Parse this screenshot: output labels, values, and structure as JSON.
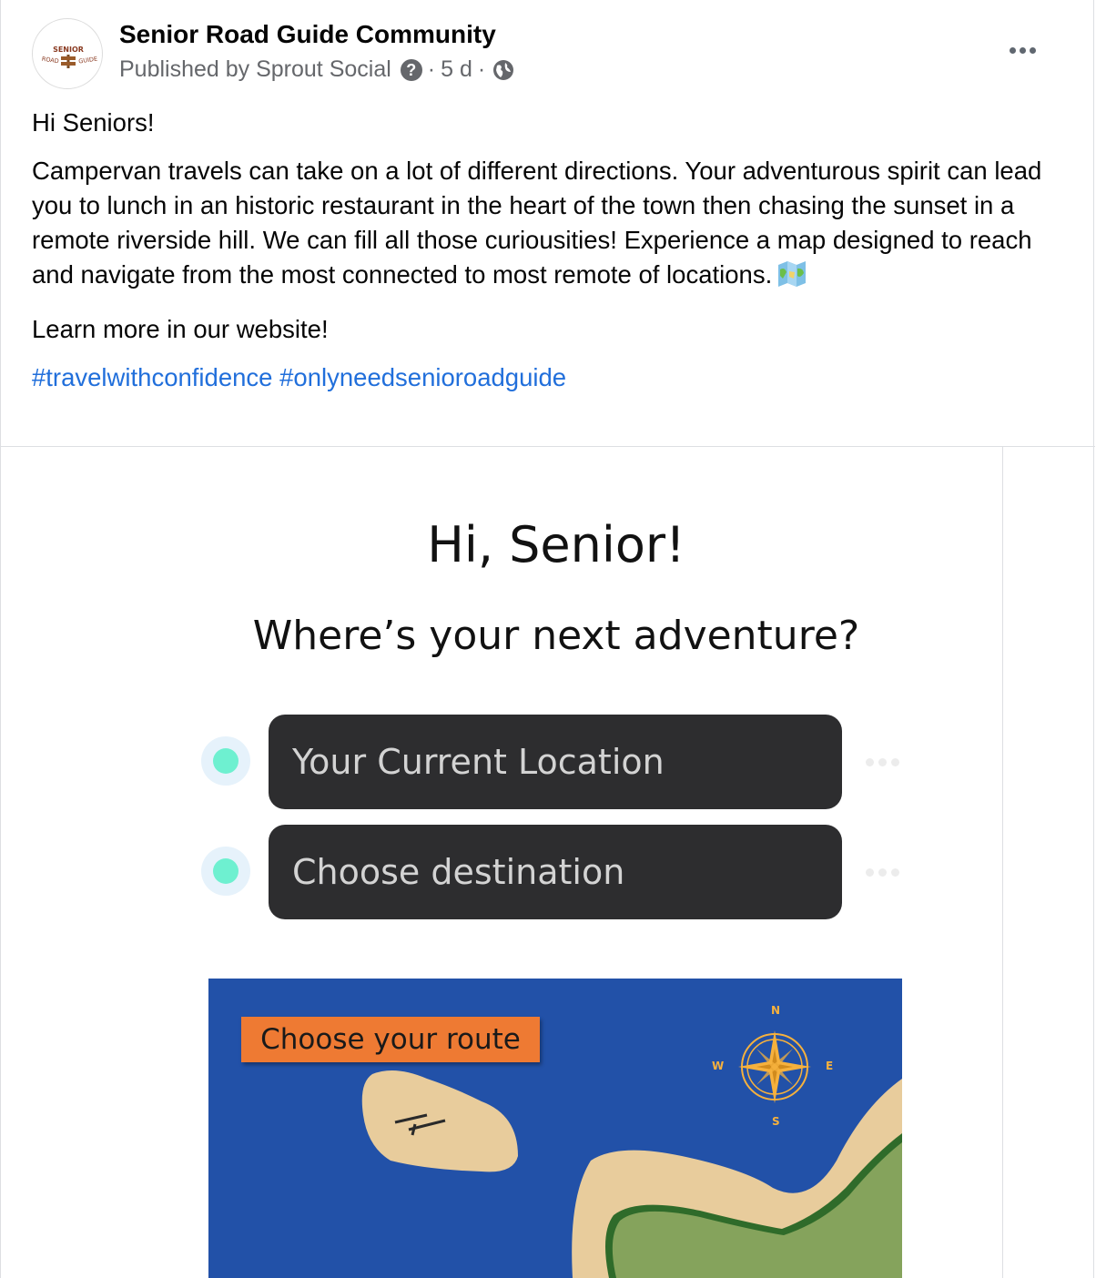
{
  "post": {
    "page_name": "Senior Road Guide Community",
    "published_by": "Published by Sprout Social",
    "help_symbol": "?",
    "separator": "·",
    "time": "5 d",
    "avatar_logo_text": "SENIOR ROAD GUIDE",
    "greeting": "Hi Seniors!",
    "paragraph": "Campervan travels can take on a lot of different directions. Your adventurous spirit can lead you to lunch in an historic restaurant in the heart of the town then chasing the sunset in a remote riverside hill. We can fill all those curiousities! Experience a map designed to reach and navigate from the most connected to most remote of locations.",
    "cta": "Learn more in our website!",
    "hashtags": [
      "#travelwithconfidence",
      "#onlyneedsenioroadguide"
    ]
  },
  "app_screen": {
    "title": "Hi, Senior!",
    "question": "Where’s your next adventure?",
    "origin_placeholder": "Your Current Location",
    "destination_placeholder": "Choose destination",
    "route_button": "Choose your route",
    "compass": {
      "n": "N",
      "e": "E",
      "s": "S",
      "w": "W"
    }
  },
  "colors": {
    "link": "#216fdb",
    "input_bg": "#2d2d2f",
    "dot": "#6ef0d0",
    "sea": "#2251a8",
    "sand": "#e8cc9c",
    "land": "#85a35c",
    "route_button": "#ee7a33",
    "compass": "#f6b13d"
  }
}
